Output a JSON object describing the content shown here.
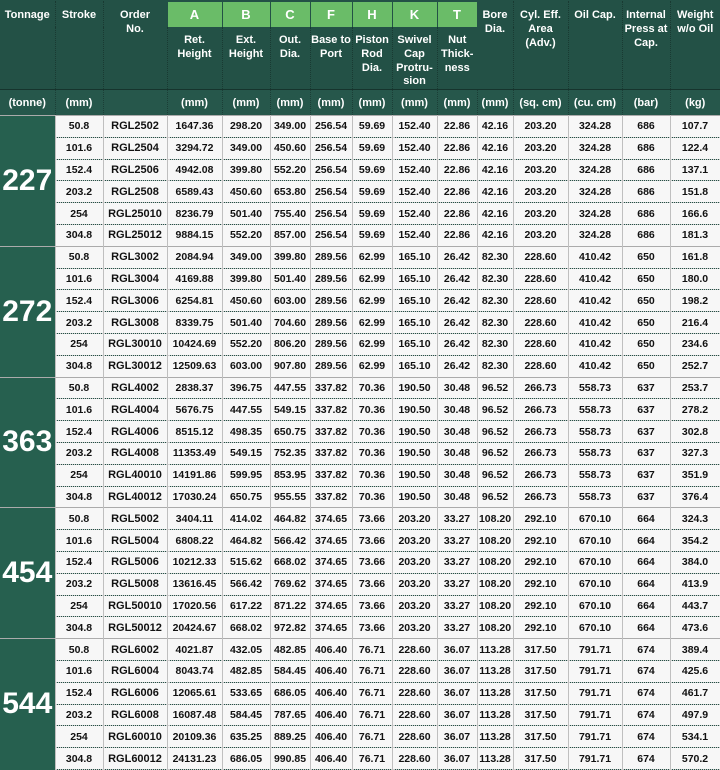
{
  "colors": {
    "header_green": "#235146",
    "letter_green": "#6abc68",
    "units_green": "#26574b",
    "tonnage_green": "#26604f",
    "row_bg": "#f7f7f7",
    "grid_border": "#bfbfbf"
  },
  "header": {
    "tonnage": {
      "label": "Tonnage",
      "unit": "(tonne)"
    },
    "stroke": {
      "label": "Stroke",
      "unit": "(mm)"
    },
    "order": {
      "label": "Order No.",
      "unit": ""
    },
    "dims": [
      {
        "letter": "A",
        "label": "Ret. Height",
        "unit": "(mm)"
      },
      {
        "letter": "B",
        "label": "Ext. Height",
        "unit": "(mm)"
      },
      {
        "letter": "C",
        "label": "Out. Dia.",
        "unit": "(mm)"
      },
      {
        "letter": "F",
        "label": "Base to Port",
        "unit": "(mm)"
      },
      {
        "letter": "H",
        "label": "Piston Rod Dia.",
        "unit": "(mm)"
      },
      {
        "letter": "K",
        "label": "Swivel Cap Protru-sion",
        "unit": "(mm)"
      },
      {
        "letter": "T",
        "label": "Nut Thick-ness",
        "unit": "(mm)"
      }
    ],
    "right": [
      {
        "label": "Bore Dia.",
        "unit": "(mm)"
      },
      {
        "label": "Cyl. Eff. Area (Adv.)",
        "unit": "(sq. cm)"
      },
      {
        "label": "Oil Cap.",
        "unit": "(cu. cm)"
      },
      {
        "label": "Internal Press at Cap.",
        "unit": "(bar)"
      },
      {
        "label": "Weight w/o Oil",
        "unit": "(kg)"
      }
    ]
  },
  "column_keys": [
    "stroke",
    "order-no",
    "dim-a-ret-height",
    "dim-b-ext-height",
    "dim-c-out-dia",
    "dim-f-base-to-port",
    "dim-h-piston-rod-dia",
    "dim-k-swivel-cap-protrusion",
    "dim-t-nut-thickness",
    "bore-dia",
    "cyl-eff-area",
    "oil-cap",
    "internal-press",
    "weight"
  ],
  "groups": [
    {
      "tonnage": "227",
      "rows": [
        [
          "50.8",
          "RGL2502",
          "1647.36",
          "298.20",
          "349.00",
          "256.54",
          "59.69",
          "152.40",
          "22.86",
          "42.16",
          "203.20",
          "324.28",
          "686",
          "107.7"
        ],
        [
          "101.6",
          "RGL2504",
          "3294.72",
          "349.00",
          "450.60",
          "256.54",
          "59.69",
          "152.40",
          "22.86",
          "42.16",
          "203.20",
          "324.28",
          "686",
          "122.4"
        ],
        [
          "152.4",
          "RGL2506",
          "4942.08",
          "399.80",
          "552.20",
          "256.54",
          "59.69",
          "152.40",
          "22.86",
          "42.16",
          "203.20",
          "324.28",
          "686",
          "137.1"
        ],
        [
          "203.2",
          "RGL2508",
          "6589.43",
          "450.60",
          "653.80",
          "256.54",
          "59.69",
          "152.40",
          "22.86",
          "42.16",
          "203.20",
          "324.28",
          "686",
          "151.8"
        ],
        [
          "254",
          "RGL25010",
          "8236.79",
          "501.40",
          "755.40",
          "256.54",
          "59.69",
          "152.40",
          "22.86",
          "42.16",
          "203.20",
          "324.28",
          "686",
          "166.6"
        ],
        [
          "304.8",
          "RGL25012",
          "9884.15",
          "552.20",
          "857.00",
          "256.54",
          "59.69",
          "152.40",
          "22.86",
          "42.16",
          "203.20",
          "324.28",
          "686",
          "181.3"
        ]
      ]
    },
    {
      "tonnage": "272",
      "rows": [
        [
          "50.8",
          "RGL3002",
          "2084.94",
          "349.00",
          "399.80",
          "289.56",
          "62.99",
          "165.10",
          "26.42",
          "82.30",
          "228.60",
          "410.42",
          "650",
          "161.8"
        ],
        [
          "101.6",
          "RGL3004",
          "4169.88",
          "399.80",
          "501.40",
          "289.56",
          "62.99",
          "165.10",
          "26.42",
          "82.30",
          "228.60",
          "410.42",
          "650",
          "180.0"
        ],
        [
          "152.4",
          "RGL3006",
          "6254.81",
          "450.60",
          "603.00",
          "289.56",
          "62.99",
          "165.10",
          "26.42",
          "82.30",
          "228.60",
          "410.42",
          "650",
          "198.2"
        ],
        [
          "203.2",
          "RGL3008",
          "8339.75",
          "501.40",
          "704.60",
          "289.56",
          "62.99",
          "165.10",
          "26.42",
          "82.30",
          "228.60",
          "410.42",
          "650",
          "216.4"
        ],
        [
          "254",
          "RGL30010",
          "10424.69",
          "552.20",
          "806.20",
          "289.56",
          "62.99",
          "165.10",
          "26.42",
          "82.30",
          "228.60",
          "410.42",
          "650",
          "234.6"
        ],
        [
          "304.8",
          "RGL30012",
          "12509.63",
          "603.00",
          "907.80",
          "289.56",
          "62.99",
          "165.10",
          "26.42",
          "82.30",
          "228.60",
          "410.42",
          "650",
          "252.7"
        ]
      ]
    },
    {
      "tonnage": "363",
      "rows": [
        [
          "50.8",
          "RGL4002",
          "2838.37",
          "396.75",
          "447.55",
          "337.82",
          "70.36",
          "190.50",
          "30.48",
          "96.52",
          "266.73",
          "558.73",
          "637",
          "253.7"
        ],
        [
          "101.6",
          "RGL4004",
          "5676.75",
          "447.55",
          "549.15",
          "337.82",
          "70.36",
          "190.50",
          "30.48",
          "96.52",
          "266.73",
          "558.73",
          "637",
          "278.2"
        ],
        [
          "152.4",
          "RGL4006",
          "8515.12",
          "498.35",
          "650.75",
          "337.82",
          "70.36",
          "190.50",
          "30.48",
          "96.52",
          "266.73",
          "558.73",
          "637",
          "302.8"
        ],
        [
          "203.2",
          "RGL4008",
          "11353.49",
          "549.15",
          "752.35",
          "337.82",
          "70.36",
          "190.50",
          "30.48",
          "96.52",
          "266.73",
          "558.73",
          "637",
          "327.3"
        ],
        [
          "254",
          "RGL40010",
          "14191.86",
          "599.95",
          "853.95",
          "337.82",
          "70.36",
          "190.50",
          "30.48",
          "96.52",
          "266.73",
          "558.73",
          "637",
          "351.9"
        ],
        [
          "304.8",
          "RGL40012",
          "17030.24",
          "650.75",
          "955.55",
          "337.82",
          "70.36",
          "190.50",
          "30.48",
          "96.52",
          "266.73",
          "558.73",
          "637",
          "376.4"
        ]
      ]
    },
    {
      "tonnage": "454",
      "rows": [
        [
          "50.8",
          "RGL5002",
          "3404.11",
          "414.02",
          "464.82",
          "374.65",
          "73.66",
          "203.20",
          "33.27",
          "108.20",
          "292.10",
          "670.10",
          "664",
          "324.3"
        ],
        [
          "101.6",
          "RGL5004",
          "6808.22",
          "464.82",
          "566.42",
          "374.65",
          "73.66",
          "203.20",
          "33.27",
          "108.20",
          "292.10",
          "670.10",
          "664",
          "354.2"
        ],
        [
          "152.4",
          "RGL5006",
          "10212.33",
          "515.62",
          "668.02",
          "374.65",
          "73.66",
          "203.20",
          "33.27",
          "108.20",
          "292.10",
          "670.10",
          "664",
          "384.0"
        ],
        [
          "203.2",
          "RGL5008",
          "13616.45",
          "566.42",
          "769.62",
          "374.65",
          "73.66",
          "203.20",
          "33.27",
          "108.20",
          "292.10",
          "670.10",
          "664",
          "413.9"
        ],
        [
          "254",
          "RGL50010",
          "17020.56",
          "617.22",
          "871.22",
          "374.65",
          "73.66",
          "203.20",
          "33.27",
          "108.20",
          "292.10",
          "670.10",
          "664",
          "443.7"
        ],
        [
          "304.8",
          "RGL50012",
          "20424.67",
          "668.02",
          "972.82",
          "374.65",
          "73.66",
          "203.20",
          "33.27",
          "108.20",
          "292.10",
          "670.10",
          "664",
          "473.6"
        ]
      ]
    },
    {
      "tonnage": "544",
      "rows": [
        [
          "50.8",
          "RGL6002",
          "4021.87",
          "432.05",
          "482.85",
          "406.40",
          "76.71",
          "228.60",
          "36.07",
          "113.28",
          "317.50",
          "791.71",
          "674",
          "389.4"
        ],
        [
          "101.6",
          "RGL6004",
          "8043.74",
          "482.85",
          "584.45",
          "406.40",
          "76.71",
          "228.60",
          "36.07",
          "113.28",
          "317.50",
          "791.71",
          "674",
          "425.6"
        ],
        [
          "152.4",
          "RGL6006",
          "12065.61",
          "533.65",
          "686.05",
          "406.40",
          "76.71",
          "228.60",
          "36.07",
          "113.28",
          "317.50",
          "791.71",
          "674",
          "461.7"
        ],
        [
          "203.2",
          "RGL6008",
          "16087.48",
          "584.45",
          "787.65",
          "406.40",
          "76.71",
          "228.60",
          "36.07",
          "113.28",
          "317.50",
          "791.71",
          "674",
          "497.9"
        ],
        [
          "254",
          "RGL60010",
          "20109.36",
          "635.25",
          "889.25",
          "406.40",
          "76.71",
          "228.60",
          "36.07",
          "113.28",
          "317.50",
          "791.71",
          "674",
          "534.1"
        ],
        [
          "304.8",
          "RGL60012",
          "24131.23",
          "686.05",
          "990.85",
          "406.40",
          "76.71",
          "228.60",
          "36.07",
          "113.28",
          "317.50",
          "791.71",
          "674",
          "570.2"
        ]
      ]
    }
  ]
}
